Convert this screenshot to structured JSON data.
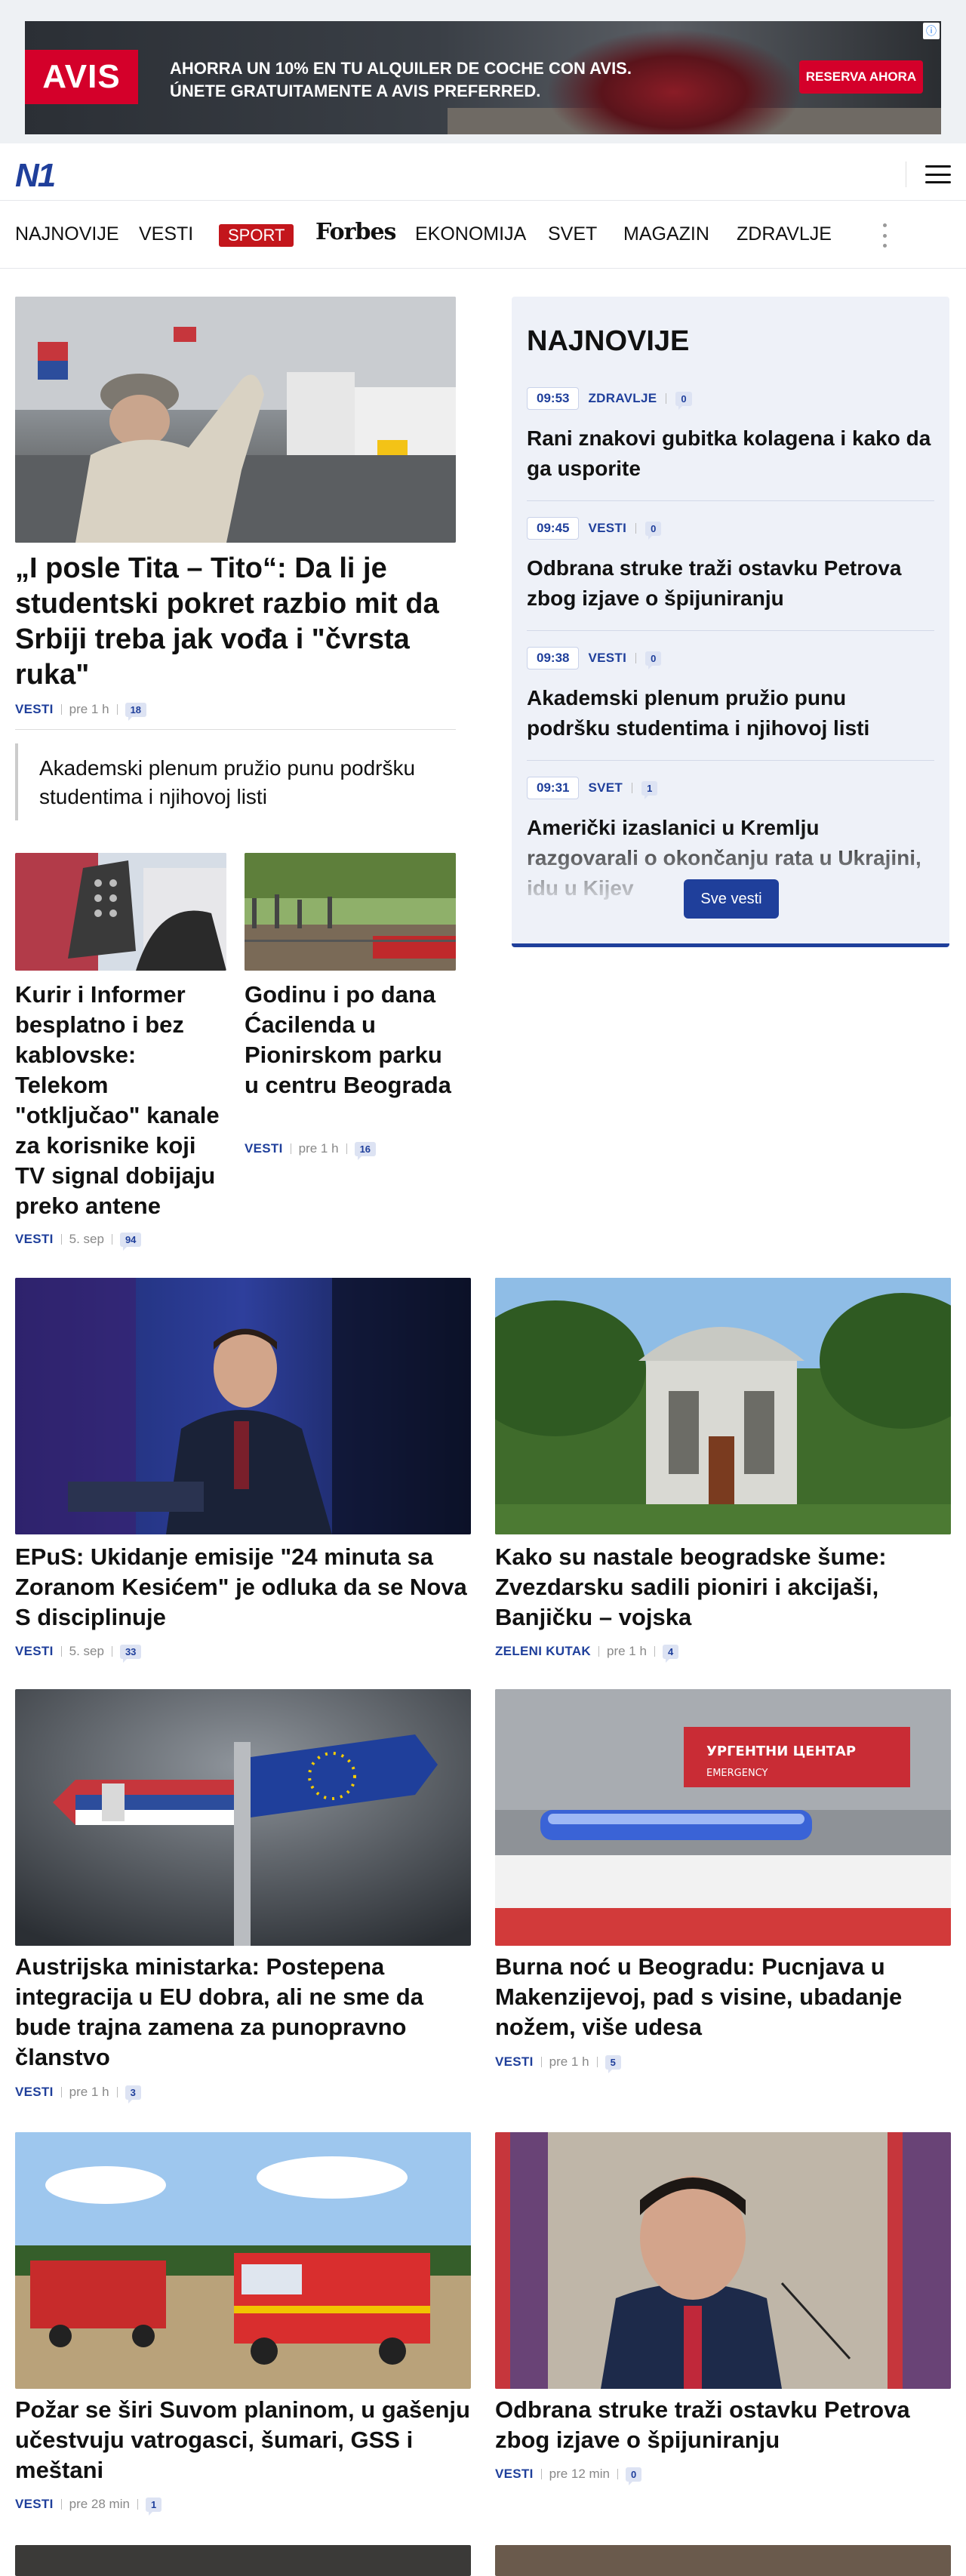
{
  "ad": {
    "brand": "AVIS",
    "headline_line1": "AHORRA UN 10% EN TU ALQUILER DE COCHE CON AVIS.",
    "headline_line2": "ÚNETE GRATUITAMENTE A AVIS PREFERRED.",
    "cta": "RESERVA AHORA",
    "badge": "AVIS",
    "info_icon": "ⓘ"
  },
  "header": {
    "logo": "N1"
  },
  "nav": {
    "items": [
      "NAJNOVIJE",
      "VESTI",
      "SPORT",
      "Forbes",
      "EKONOMIJA",
      "SVET",
      "MAGAZIN",
      "ZDRAVLJE"
    ]
  },
  "lead": {
    "title": "„I posle Tita – Tito“: Da li je studentski pokret razbio mit da Srbiji treba jak vođa i \"čvrsta ruka\"",
    "category": "VESTI",
    "time": "pre 1 h",
    "comments": "18"
  },
  "quote": {
    "text": "Akademski plenum pružio punu podršku studentima i njihovoj listi"
  },
  "small_cards": [
    {
      "title": "Kurir i Informer besplatno i bez kablovske: Telekom \"otključao\" kanale za korisnike koji TV signal dobijaju preko antene",
      "category": "VESTI",
      "time": "5. sep",
      "comments": "94"
    },
    {
      "title": "Godinu i po dana Ćacilenda u Pionirskom parku u centru Beograda",
      "category": "VESTI",
      "time": "pre 1 h",
      "comments": "16"
    }
  ],
  "sidebar": {
    "title": "NAJNOVIJE",
    "items": [
      {
        "time": "09:53",
        "category": "ZDRAVLJE",
        "comments": "0",
        "title": "Rani znakovi gubitka kolagena i kako da ga usporite"
      },
      {
        "time": "09:45",
        "category": "VESTI",
        "comments": "0",
        "title": "Odbrana struke traži ostavku Petrova zbog izjave o špijuniranju"
      },
      {
        "time": "09:38",
        "category": "VESTI",
        "comments": "0",
        "title": "Akademski plenum pružio punu podršku studentima i njihovoj listi"
      },
      {
        "time": "09:31",
        "category": "SVET",
        "comments": "1",
        "title": "Američki izaslanici u Kremlju razgovarali o okončanju rata u Ukrajini, idu u Kijev"
      }
    ],
    "button": "Sve vesti"
  },
  "grid": [
    {
      "title": "EPuS: Ukidanje emisije \"24 minuta sa Zoranom Kesićem\" je odluka da se Nova S disciplinuje",
      "category": "VESTI",
      "time": "5. sep",
      "comments": "33"
    },
    {
      "title": "Kako su nastale beogradske šume: Zvezdarsku sadili pioniri i akcijaši, Banjičku – vojska",
      "category": "ZELENI KUTAK",
      "time": "pre 1 h",
      "comments": "4"
    },
    {
      "title": "Austrijska ministarka: Postepena integracija u EU dobra, ali ne sme da bude trajna zamena za punopravno članstvo",
      "category": "VESTI",
      "time": "pre 1 h",
      "comments": "3"
    },
    {
      "title": "Burna noć u Beogradu: Pucnjava u Makenzijevoj, pad s visine, ubadanje nožem, više udesa",
      "category": "VESTI",
      "time": "pre 1 h",
      "comments": "5"
    },
    {
      "title": "Požar se širi Suvom planinom, u gašenju učestvuju vatrogasci, šumari, GSS i meštani",
      "category": "VESTI",
      "time": "pre 28 min",
      "comments": "1"
    },
    {
      "title": "Odbrana struke traži ostavku Petrova zbog izjave o špijuniranju",
      "category": "VESTI",
      "time": "pre 12 min",
      "comments": "0"
    }
  ],
  "images": {
    "sign_text": "УРГЕНТНИ ЦЕНТАР",
    "sign_sub": "EMERGENCY"
  }
}
